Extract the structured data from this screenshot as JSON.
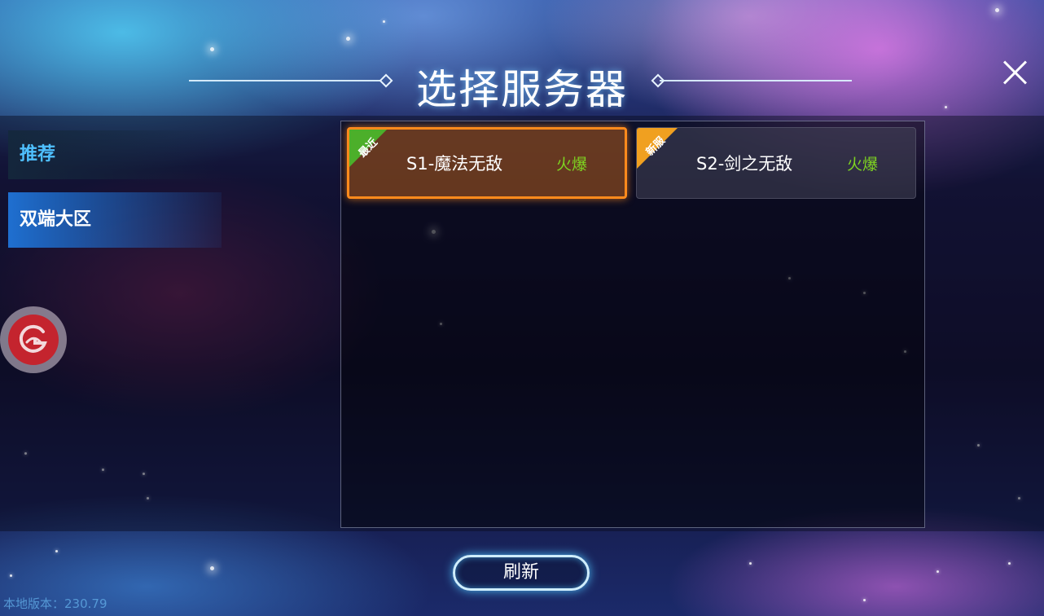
{
  "header": {
    "title": "选择服务器"
  },
  "sidebar": {
    "items": [
      {
        "label": "推荐",
        "active": false
      },
      {
        "label": "双端大区",
        "active": true
      }
    ]
  },
  "servers": [
    {
      "tag": "最近",
      "name": "S1-魔法无敌",
      "status": "火爆",
      "selected": true
    },
    {
      "tag": "新服",
      "name": "S2-剑之无敌",
      "status": "火爆",
      "selected": false
    }
  ],
  "footer": {
    "refresh_label": "刷新",
    "version_text": "本地版本：230.79"
  },
  "colors": {
    "status_hot": "#7ed321",
    "selected_border": "#ff8a1c",
    "tag_recent": "#4caf2a",
    "tag_new": "#f0a020",
    "sidebar_active": "#1f6fd0",
    "sidebar_recommend_text": "#4fc0ff"
  }
}
